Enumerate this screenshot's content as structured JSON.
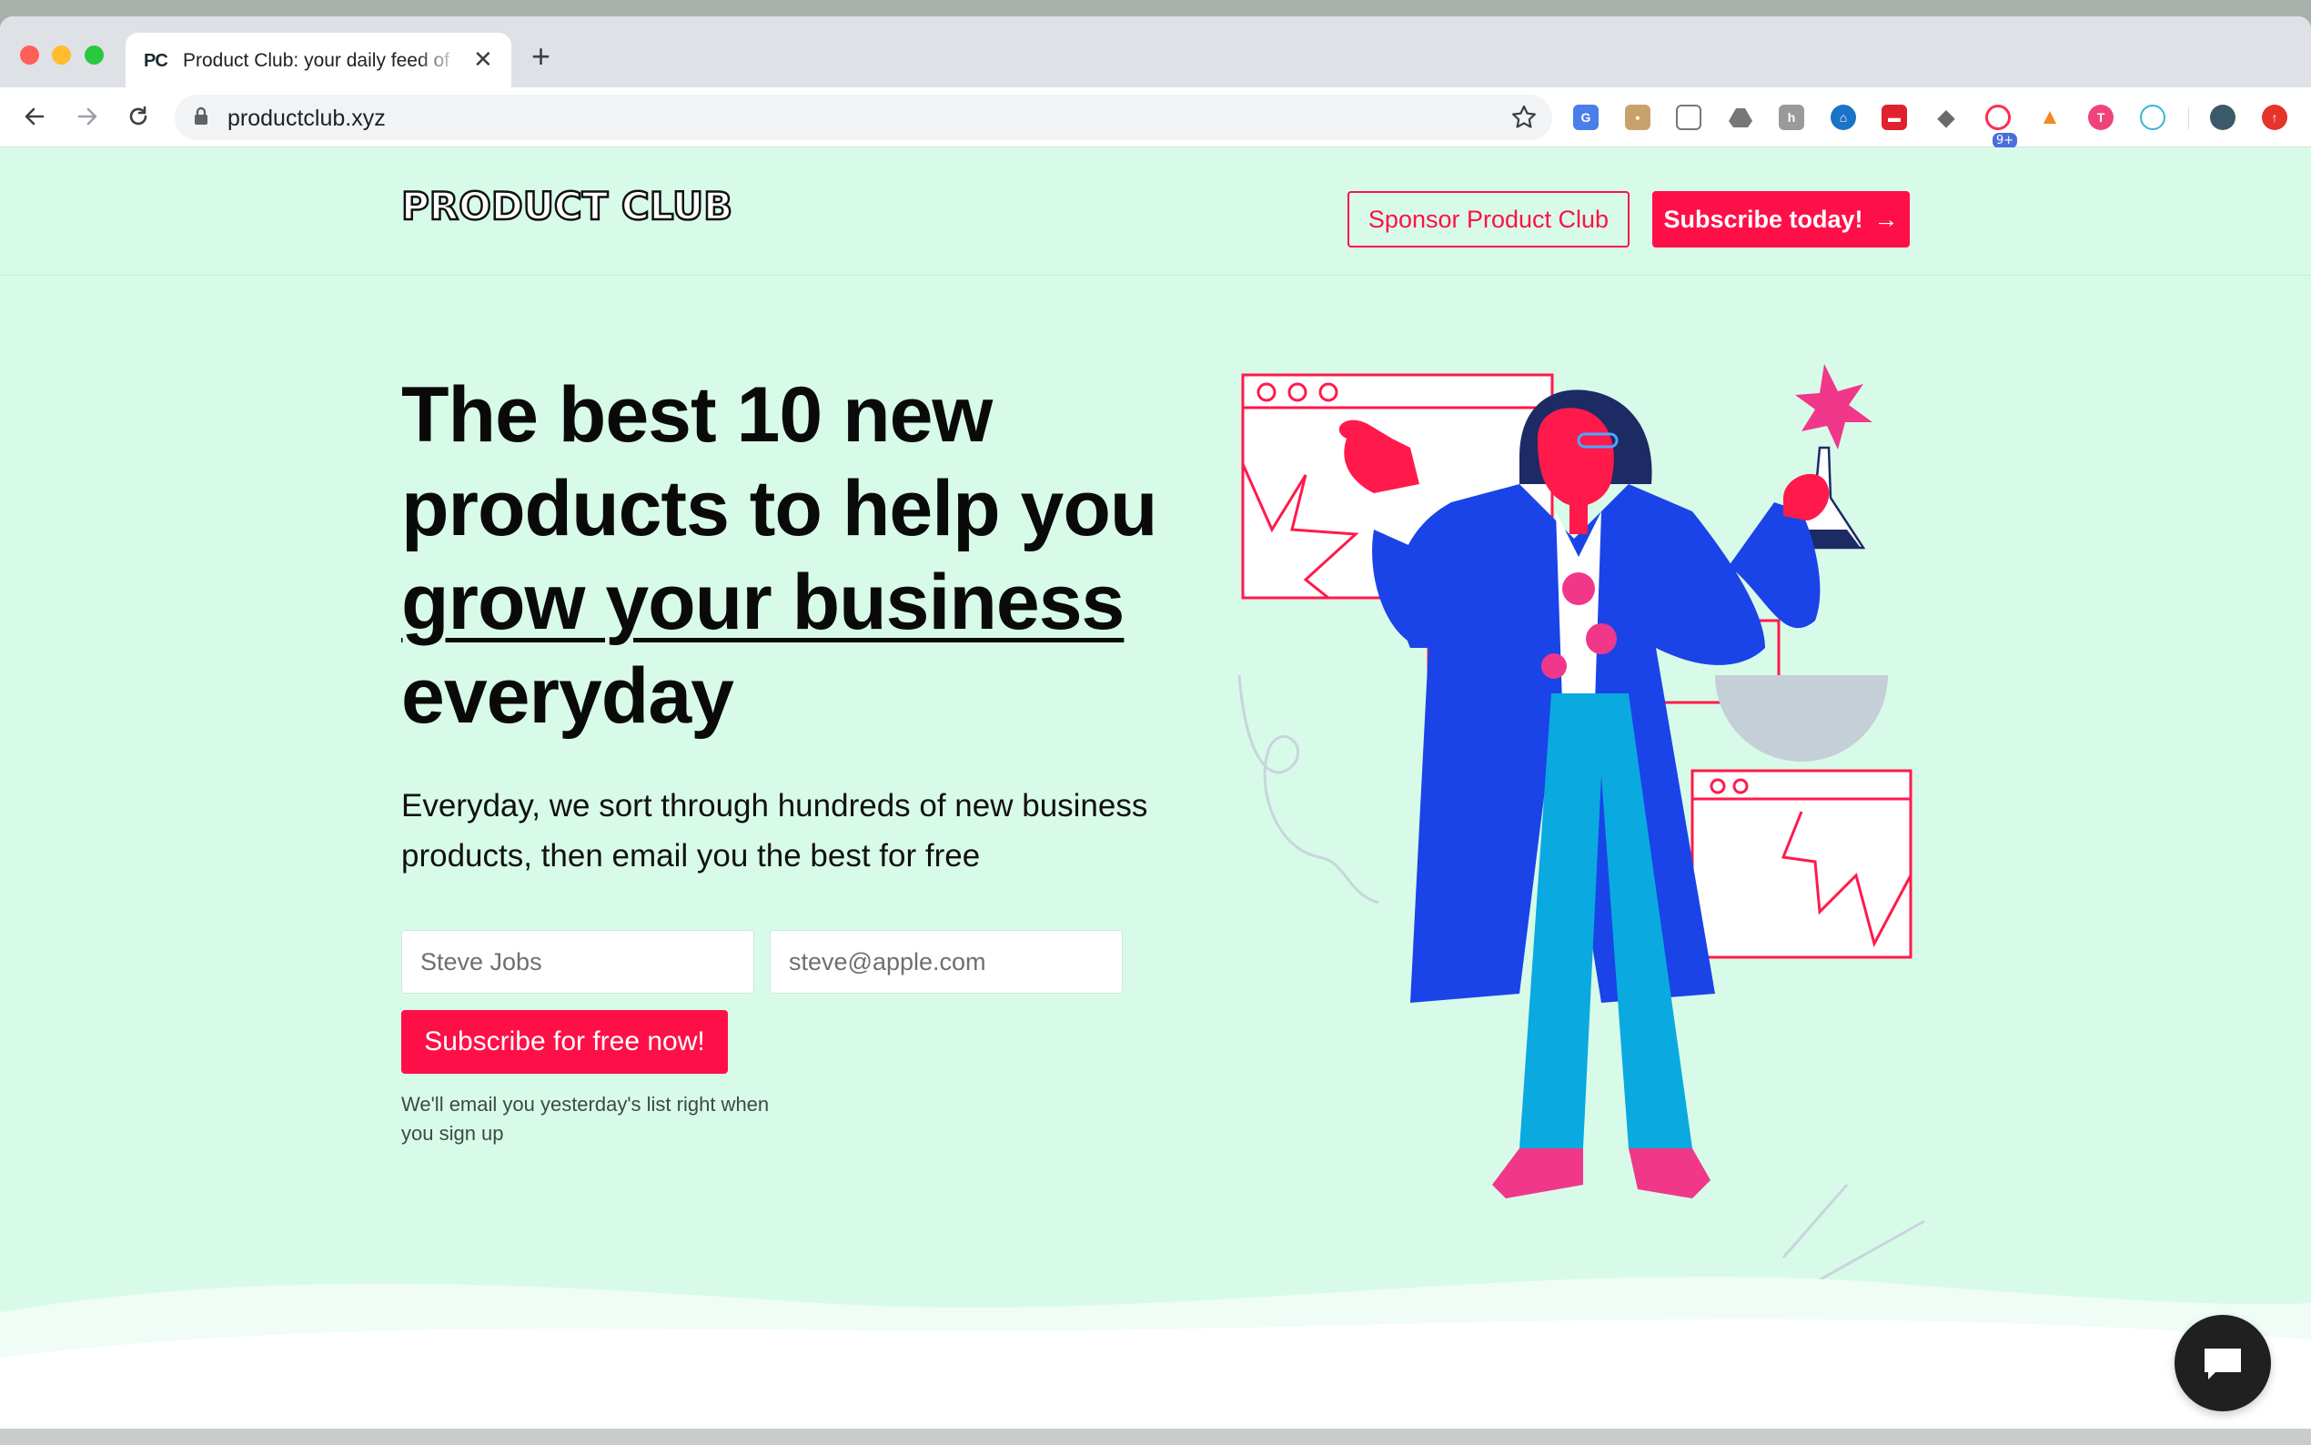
{
  "browser": {
    "tab_favicon": "PC",
    "tab_title": "Product Club: your daily feed of",
    "tab_close": "✕",
    "new_tab": "+",
    "url": "productclub.xyz",
    "extension_badge": "9+"
  },
  "header": {
    "logo": "PRODUCT CLUB",
    "sponsor_label": "Sponsor Product Club",
    "subscribe_label": "Subscribe today!",
    "subscribe_arrow": "→"
  },
  "hero": {
    "title_1": "The best ",
    "title_2": "10 new products to help you ",
    "title_3": "grow your business",
    "title_4": " everyday",
    "subtitle": "Everyday, we sort through hundreds of new business products, then email you the best for free"
  },
  "form": {
    "name_placeholder": "Steve Jobs",
    "email_placeholder": "steve@apple.com",
    "submit_label": "Subscribe for free now!",
    "note": "We'll email you yesterday's list right when you sign up"
  },
  "colors": {
    "accent": "#ff0f48",
    "page_bg": "#d8fbe9",
    "figure_coat": "#1a44e8",
    "figure_pants": "#0aa9e0",
    "figure_pink": "#f0378a"
  },
  "icons": [
    "back-icon",
    "forward-icon",
    "reload-icon",
    "lock-icon",
    "star-icon",
    "chat-icon",
    "arrow-right-icon"
  ]
}
